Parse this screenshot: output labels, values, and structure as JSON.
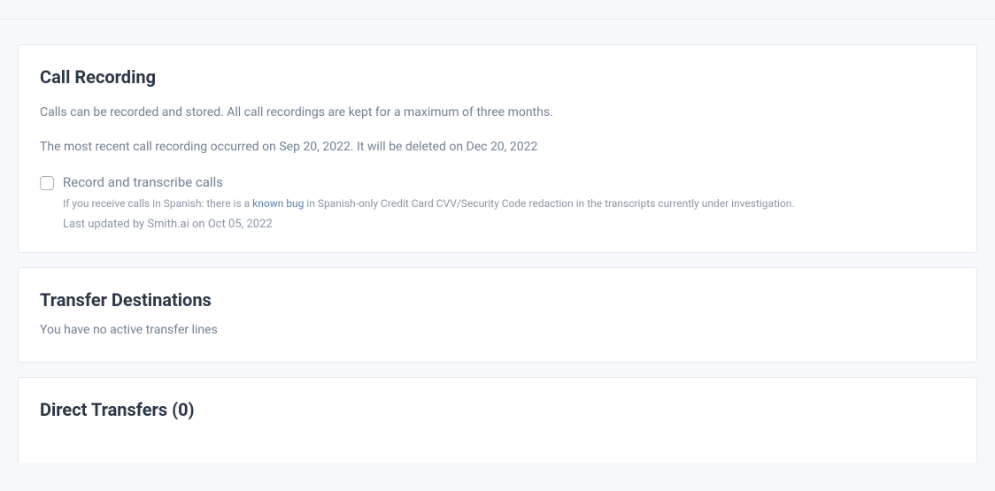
{
  "callRecording": {
    "title": "Call Recording",
    "description": "Calls can be recorded and stored. All call recordings are kept for a maximum of three months.",
    "statusText": "The most recent call recording occurred on Sep 20, 2022. It will be deleted on Dec 20, 2022",
    "checkbox": {
      "label": "Record and transcribe calls",
      "helperPrefix": "If you receive calls in Spanish: there is a ",
      "helperLink": "known bug",
      "helperSuffix": " in Spanish-only Credit Card CVV/Security Code redaction in the transcripts currently under investigation.",
      "lastUpdated": "Last updated by Smith.ai on Oct 05, 2022"
    }
  },
  "transferDestinations": {
    "title": "Transfer Destinations",
    "noLinesText": "You have no active transfer lines"
  },
  "directTransfers": {
    "title": "Direct Transfers (0)"
  }
}
